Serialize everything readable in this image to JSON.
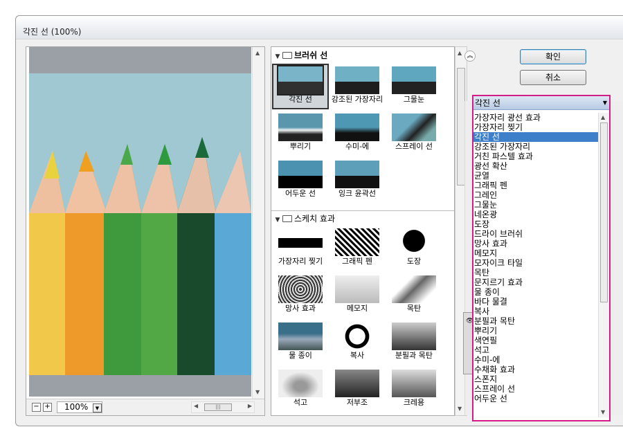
{
  "window": {
    "title": "각진 선 (100%)"
  },
  "preview": {
    "zoom": "100%",
    "zoom_minus": "−",
    "zoom_plus": "+"
  },
  "gallery": {
    "categories": [
      {
        "name": "브러쉬 선",
        "items": [
          "각진 선",
          "강조된 가장자리",
          "그물눈",
          "뿌리기",
          "수미-에",
          "스프레이 선",
          "어두운 선",
          "잉크 윤곽선"
        ]
      },
      {
        "name": "스케치 효과",
        "items": [
          "가장자리 찢기",
          "그래픽 펜",
          "도장",
          "망사 효과",
          "메모지",
          "목탄",
          "물 종이",
          "복사",
          "분필과 목탄",
          "석고",
          "저부조",
          "크레용"
        ]
      }
    ],
    "selected": "각진 선"
  },
  "buttons": {
    "ok": "확인",
    "cancel": "취소"
  },
  "filter": {
    "selected": "각진 선",
    "options": [
      "가장자리 광선 효과",
      "가장자리 찢기",
      "각진 선",
      "강조된 가장자리",
      "거친 파스텔 효과",
      "광선 확산",
      "균열",
      "그래픽 펜",
      "그레인",
      "그물눈",
      "네온광",
      "도장",
      "드라이 브러쉬",
      "망사 효과",
      "메모지",
      "모자이크 타일",
      "목탄",
      "문지르기 효과",
      "물 종이",
      "바다 물결",
      "복사",
      "분필과 목탄",
      "뿌리기",
      "색연필",
      "석고",
      "수미-에",
      "수채화 효과",
      "스폰지",
      "스프레이 선",
      "어두운 선"
    ]
  },
  "colors": {
    "highlight_border": "#d31c86",
    "selection": "#3d7fc8"
  }
}
